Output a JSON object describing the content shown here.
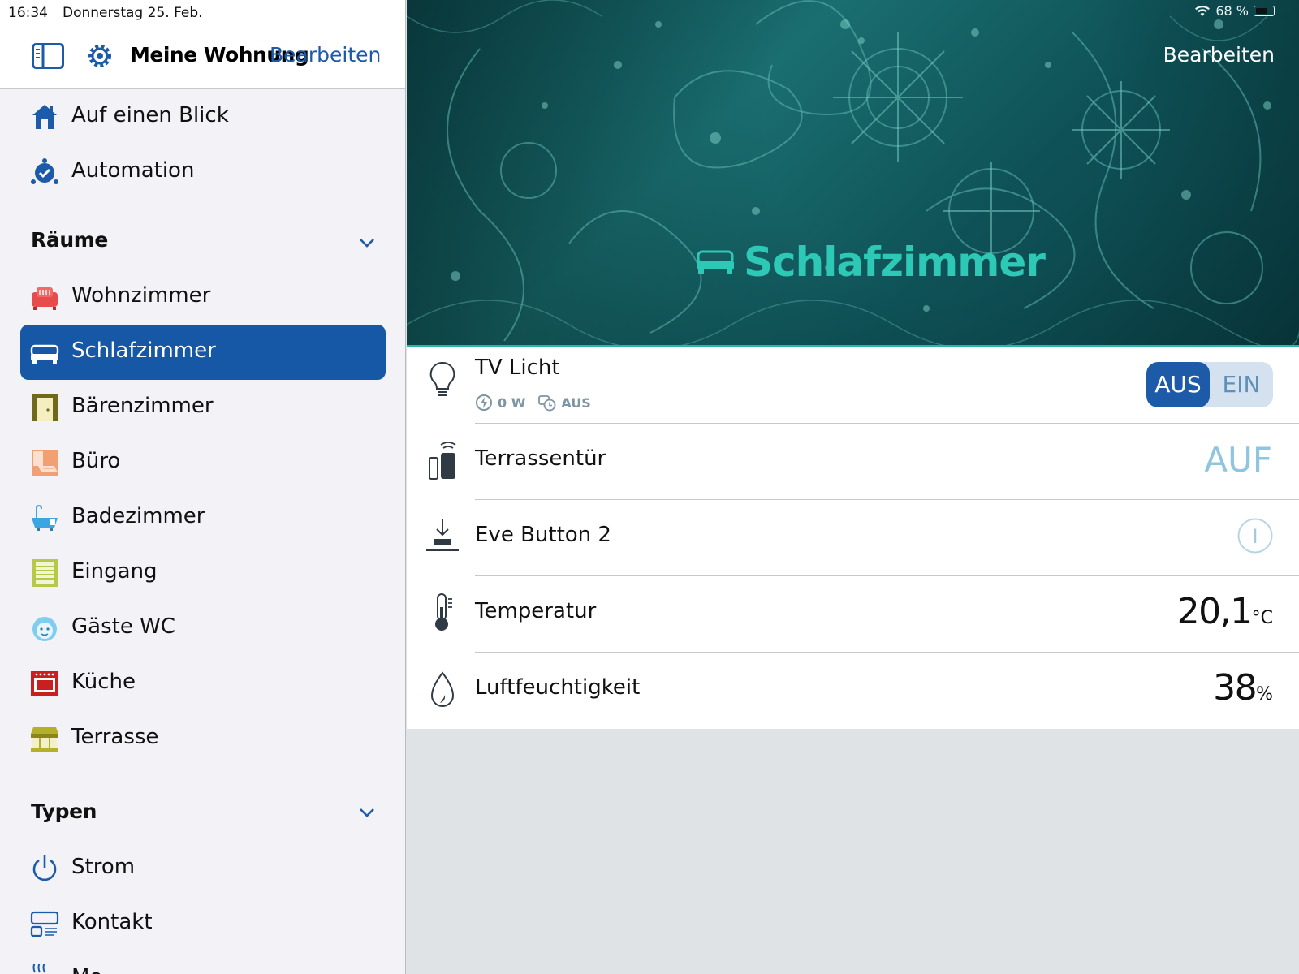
{
  "status_bar": {
    "time": "16:34",
    "date": "Donnerstag 25. Feb.",
    "battery": "68 %"
  },
  "sidebar": {
    "home_name": "Meine Wohnung",
    "edit_label": "Bearbeiten",
    "top_items": [
      {
        "label": "Auf einen Blick",
        "icon": "house-icon"
      },
      {
        "label": "Automation",
        "icon": "automation-icon"
      }
    ],
    "rooms_header": "Räume",
    "rooms": [
      {
        "label": "Wohnzimmer",
        "icon": "sofa-icon"
      },
      {
        "label": "Schlafzimmer",
        "icon": "bed-icon",
        "selected": true
      },
      {
        "label": "Bärenzimmer",
        "icon": "door-icon"
      },
      {
        "label": "Büro",
        "icon": "desk-icon"
      },
      {
        "label": "Badezimmer",
        "icon": "bathtub-icon"
      },
      {
        "label": "Eingang",
        "icon": "shelf-icon"
      },
      {
        "label": "Gäste WC",
        "icon": "face-icon"
      },
      {
        "label": "Küche",
        "icon": "oven-icon"
      },
      {
        "label": "Terrasse",
        "icon": "awning-icon"
      }
    ],
    "types_header": "Typen",
    "types": [
      {
        "label": "Strom",
        "icon": "power-icon"
      },
      {
        "label": "Kontakt",
        "icon": "contact-sensor-icon"
      },
      {
        "label": "Mo",
        "icon": "motion-icon"
      }
    ]
  },
  "main": {
    "edit_label": "Bearbeiten",
    "room_title": "Schlafzimmer",
    "accent_color": "#2ec9b6",
    "devices": [
      {
        "name": "TV Licht",
        "icon": "lightbulb-icon",
        "power": "0 W",
        "timer": "AUS",
        "toggle": {
          "off_label": "AUS",
          "on_label": "EIN",
          "state": "AUS"
        }
      },
      {
        "name": "Terrassentür",
        "icon": "door-sensor-icon",
        "state": "AUF"
      },
      {
        "name": "Eve Button 2",
        "icon": "button-press-icon",
        "state_symbol": "I"
      },
      {
        "name": "Temperatur",
        "icon": "thermometer-icon",
        "value": "20,1",
        "unit": "°C"
      },
      {
        "name": "Luftfeuchtigkeit",
        "icon": "droplet-icon",
        "value": "38",
        "unit": "%"
      }
    ]
  }
}
